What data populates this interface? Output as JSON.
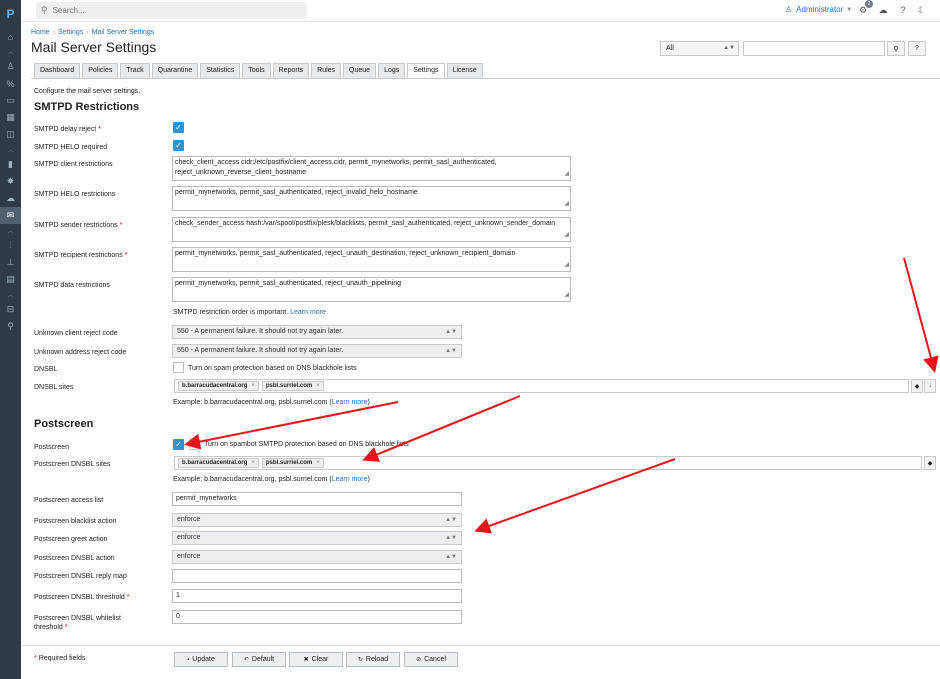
{
  "sidebar": {
    "logo": "P",
    "icons": [
      "home-icon",
      "collapse-icon",
      "user-icon",
      "percent-icon",
      "monitor-icon",
      "dashboard-icon",
      "book-icon",
      "collapse-icon",
      "chart-icon",
      "bug-icon",
      "cloud-icon",
      "mail-icon",
      "collapse-icon",
      "sliders-icon",
      "stats-icon",
      "grid-icon",
      "collapse-icon",
      "inbox-icon",
      "wrench-icon"
    ]
  },
  "topbar": {
    "search_placeholder": "Search...",
    "user": "Administrator",
    "notification_count": "2"
  },
  "breadcrumb": [
    "Home",
    "Settings",
    "Mail Server Settings"
  ],
  "page_title": "Mail Server Settings",
  "filter": {
    "select_value": "All"
  },
  "tabs": [
    "Dashboard",
    "Policies",
    "Track",
    "Quarantine",
    "Statistics",
    "Tools",
    "Reports",
    "Rules",
    "Queue",
    "Logs",
    "Settings",
    "License"
  ],
  "active_tab": "Settings",
  "description": "Configure the mail server settings.",
  "smtpd": {
    "title": "SMTPD Restrictions",
    "delay_reject_label": "SMTPD delay reject",
    "helo_required_label": "SMTPD HELO required",
    "client_label": "SMTPD client restrictions",
    "client_value": "check_client_access cidr:/etc/postfix/client_access.cidr, permit_mynetworks, permit_sasl_authenticated, reject_unknown_reverse_client_hostname",
    "helo_label": "SMTPD HELO restrictions",
    "helo_value": "permit_mynetworks, permit_sasl_authenticated, reject_invalid_helo_hostname",
    "sender_label": "SMTPD sender restrictions",
    "sender_value": "check_sender_access hash:/var/spool/postfix/plesk/blacklists, permit_sasl_authenticated, reject_unknown_sender_domain",
    "recipient_label": "SMTPD recipient restrictions",
    "recipient_value": "permit_mynetworks, permit_sasl_authenticated, reject_unauth_destination, reject_unknown_recipient_domain",
    "data_label": "SMTPD data restrictions",
    "data_value": "permit_mynetworks, permit_sasl_authenticated, reject_unauth_pipelining",
    "order_note": "SMTPD restriction order is important.",
    "learn_more": "Learn more",
    "unknown_client_label": "Unknown client reject code",
    "unknown_client_value": "550 - A permanent failure. It should not try again later.",
    "unknown_address_label": "Unknown address reject code",
    "unknown_address_value": "550 - A permanent failure. It should not try again later.",
    "dnsbl_label": "DNSBL",
    "dnsbl_text": "Turn on spam protection based on DNS blackhole lists",
    "dnsbl_sites_label": "DNSBL sites",
    "dnsbl_sites": [
      "b.barracudacentral.org",
      "psbl.surriel.com"
    ],
    "example_prefix": "Example: b.barracudacentral.org, psbl.surriel.com (",
    "example_suffix": ")"
  },
  "postscreen": {
    "title": "Postscreen",
    "postscreen_label": "Postscreen",
    "postscreen_text": "Turn on spambot SMTPD protection based on DNS blackhole lists",
    "dnsbl_sites_label": "Postscreen DNSBL sites",
    "dnsbl_sites": [
      "b.barracudacentral.org",
      "psbl.surriel.com"
    ],
    "example_prefix": "Example: b.barracudacentral.org, psbl.surriel.com (",
    "learn_more": "Learn more",
    "example_suffix": ")",
    "access_list_label": "Postscreen access list",
    "access_list_value": "permit_mynetworks",
    "blacklist_label": "Postscreen blacklist action",
    "blacklist_value": "enforce",
    "greet_label": "Postscreen greet action",
    "greet_value": "enforce",
    "dnsbl_action_label": "Postscreen DNSBL action",
    "dnsbl_action_value": "enforce",
    "reply_map_label": "Postscreen DNSBL reply map",
    "reply_map_value": "",
    "threshold_label": "Postscreen DNSBL threshold",
    "threshold_value": "1",
    "whitelist_label_1": "Postscreen DNSBL whitelist",
    "whitelist_label_2": "threshold",
    "whitelist_value": "0"
  },
  "footer": {
    "required_note": "Required fields",
    "buttons": [
      "Update",
      "Default",
      "Clear",
      "Reload",
      "Cancel"
    ]
  },
  "colors": {
    "accent": "#2f93d3",
    "link": "#1f6fbf",
    "sidebar": "#2e3b47",
    "annotation_arrow": "#e8141b"
  }
}
